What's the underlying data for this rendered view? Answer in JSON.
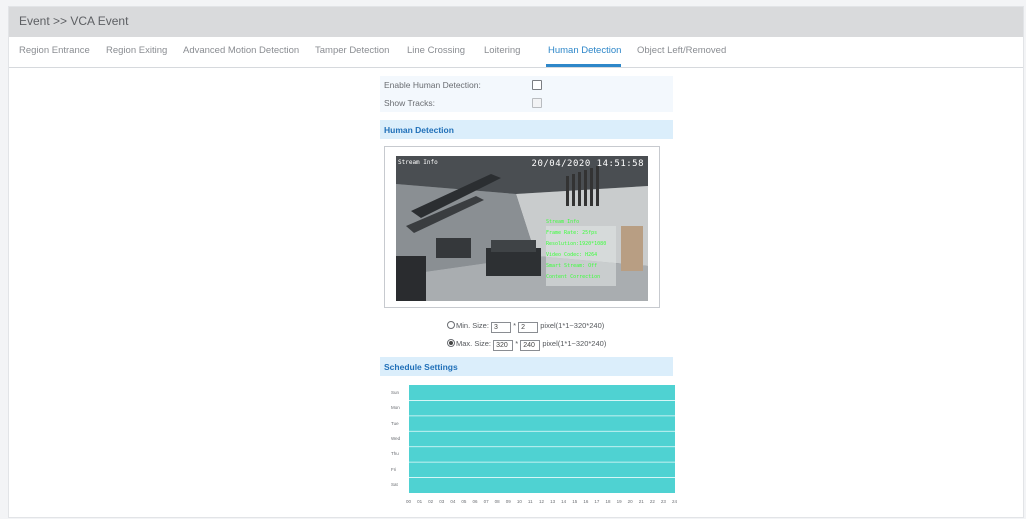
{
  "header": {
    "title": "Event >> VCA Event"
  },
  "tabs": [
    {
      "label": "Region Entrance",
      "active": false
    },
    {
      "label": "Region Exiting",
      "active": false
    },
    {
      "label": "Advanced Motion Detection",
      "active": false
    },
    {
      "label": "Tamper Detection",
      "active": false
    },
    {
      "label": "Line Crossing",
      "active": false
    },
    {
      "label": "Loitering",
      "active": false
    },
    {
      "label": "Human Detection",
      "active": true
    },
    {
      "label": "Object Left/Removed",
      "active": false
    }
  ],
  "settings": {
    "enable_label": "Enable Human Detection:",
    "enable_checked": false,
    "show_tracks_label": "Show Tracks:",
    "show_tracks_checked": false
  },
  "human_section": {
    "title": "Human Detection"
  },
  "preview": {
    "timestamp": "20/04/2020 14:51:58",
    "osd_lines": [
      "Stream Info",
      "Frame Rate: 25fps",
      "Resolution:1920*1080",
      "Video Codec: H264",
      "Smart Stream: Off",
      "Content Correction"
    ]
  },
  "min_size": {
    "label": "Min. Size:",
    "width": "3",
    "height": "2",
    "times": "*",
    "range": "pixel(1*1~320*240)",
    "selected": false
  },
  "max_size": {
    "label": "Max. Size:",
    "width": "320",
    "height": "240",
    "times": "*",
    "range": "pixel(1*1~320*240)",
    "selected": true
  },
  "schedule_section": {
    "title": "Schedule Settings"
  },
  "schedule": {
    "days": [
      "Sun",
      "Mon",
      "Tue",
      "Wed",
      "Thu",
      "Fri",
      "Sat"
    ],
    "hours": [
      "00",
      "01",
      "02",
      "03",
      "04",
      "05",
      "06",
      "07",
      "08",
      "09",
      "10",
      "11",
      "12",
      "13",
      "14",
      "15",
      "16",
      "17",
      "18",
      "19",
      "20",
      "21",
      "22",
      "23",
      "24"
    ],
    "fill_color": "#4fd2d2",
    "line_color": "#e9fbfb",
    "coverage": "all-days-all-hours"
  },
  "colors": {
    "accent": "#2e87c9",
    "section_bg": "#dbeefb",
    "header_bg": "#d9dadc"
  }
}
